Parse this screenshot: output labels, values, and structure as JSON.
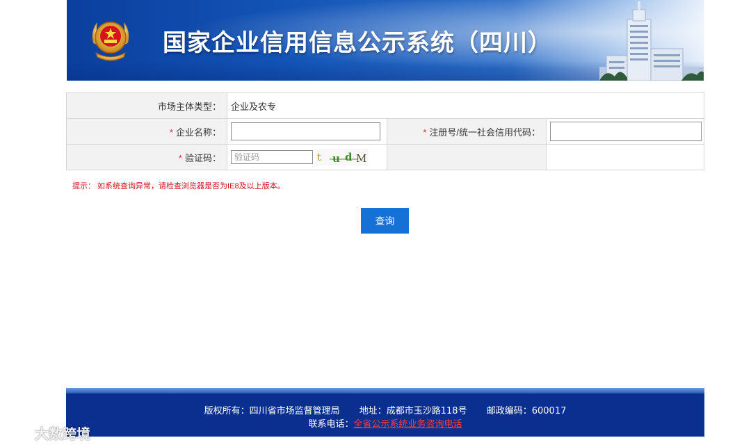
{
  "header": {
    "title": "国家企业信用信息公示系统（四川）",
    "emblem_icon": "national-emblem-icon",
    "building_image": "building-icon"
  },
  "form": {
    "market_type": {
      "label": "市场主体类型：",
      "value": "企业及农专"
    },
    "company_name": {
      "required_mark": "*",
      "label": "企业名称：",
      "value": ""
    },
    "reg_number": {
      "required_mark": "*",
      "label": "注册号/统一社会信用代码：",
      "value": ""
    },
    "captcha": {
      "required_mark": "*",
      "label": "验证码：",
      "placeholder": "验证码",
      "image_text": "t u d M"
    }
  },
  "tip": "提示： 如系统查询异常，请检查浏览器是否为IE8及以上版本。",
  "query_button": "查询",
  "footer": {
    "copyright": "版权所有：四川省市场监督管理局",
    "address": "地址：成都市玉沙路118号",
    "postcode": "邮政编码：600017",
    "hotline_label": "联系电话：",
    "hotline_link": "全省公示系统业务咨询电话"
  },
  "watermark": "大数跨境",
  "colors": {
    "header_blue": "#0b3f9e",
    "button_blue": "#1571d6",
    "footer_blue": "#0a2f8f",
    "required_red": "#e0262b",
    "tip_red": "#d0141b"
  }
}
